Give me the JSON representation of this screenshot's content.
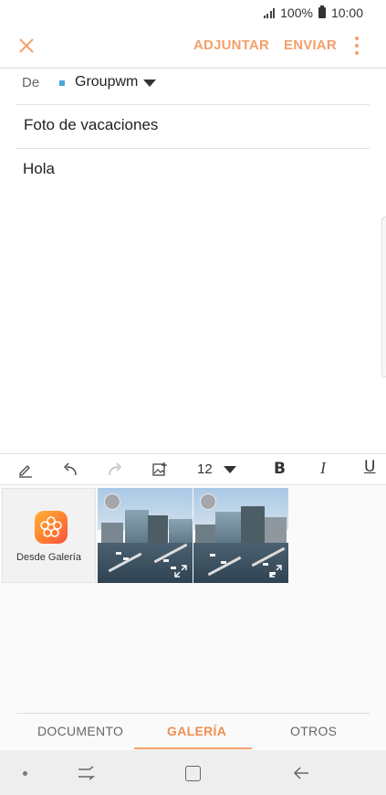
{
  "status_bar": {
    "battery": "100%",
    "time": "10:00"
  },
  "app_bar": {
    "close_icon": "close-icon",
    "attach_label": "ADJUNTAR",
    "send_label": "ENVIAR",
    "more_icon": "more-vertical-icon",
    "accent_color": "#f3a06b"
  },
  "compose": {
    "from_label": "De",
    "from_value": "Groupwm",
    "subject": "Foto de vacaciones",
    "body": "Hola"
  },
  "format_toolbar": {
    "icons": [
      "pen-icon",
      "undo-icon",
      "redo-icon",
      "insert-image-icon"
    ],
    "font_size": "12",
    "bold": "B",
    "italic": "I",
    "underline": "U"
  },
  "gallery": {
    "from_gallery_label": "Desde Galería",
    "thumbnails": [
      {
        "name": "harbor-photo-1",
        "selected": false
      },
      {
        "name": "harbor-photo-2",
        "selected": false
      }
    ]
  },
  "tabs": {
    "items": [
      "DOCUMENTO",
      "GALERÍA",
      "OTROS"
    ],
    "active": "GALERÍA"
  },
  "nav_bar": {
    "icons": [
      "dot-icon",
      "recents-icon",
      "home-icon",
      "back-icon"
    ]
  }
}
